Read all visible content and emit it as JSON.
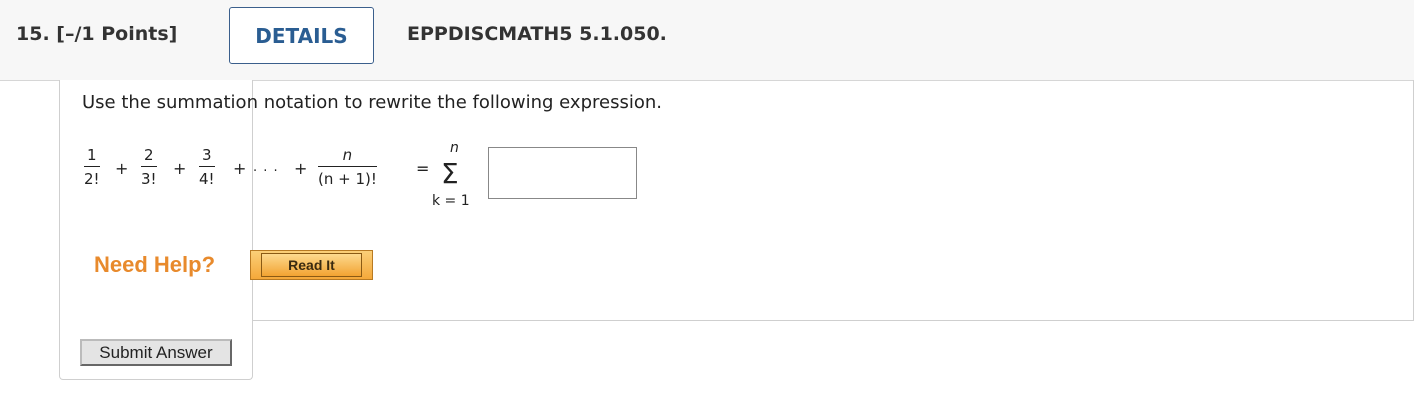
{
  "header": {
    "question_number": "15.",
    "points": "[–/1 Points]",
    "details_label": "DETAILS",
    "question_id": "EPPDISCMATH5 5.1.050."
  },
  "question": {
    "prompt": "Use the summation notation to rewrite the following expression.",
    "terms": [
      {
        "num": "1",
        "den": "2!"
      },
      {
        "num": "2",
        "den": "3!"
      },
      {
        "num": "3",
        "den": "4!"
      }
    ],
    "plus": "+",
    "ellipsis": ". . .",
    "last_term": {
      "num": "n",
      "den": "(n + 1)!"
    },
    "equals": "=",
    "sigma": "Σ",
    "sigma_upper": "n",
    "sigma_lower": "k = 1",
    "answer_value": ""
  },
  "help": {
    "need_help_label": "Need Help?",
    "read_it_label": "Read It"
  },
  "actions": {
    "submit_label": "Submit Answer"
  },
  "colors": {
    "details_border": "#3b5f8c",
    "details_text": "#2a5d92",
    "need_help": "#e88a2c",
    "read_it_fill": "#f4a83a"
  }
}
